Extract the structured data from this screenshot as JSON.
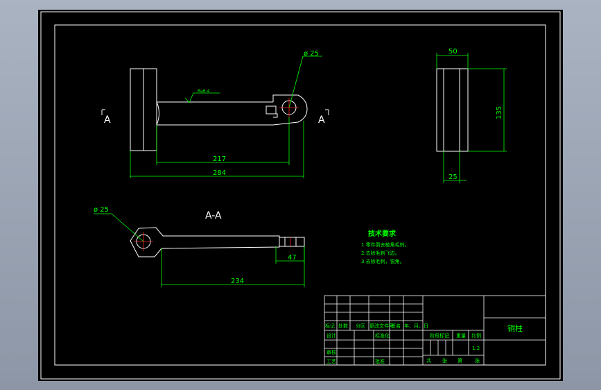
{
  "colors": {
    "background": "#000000",
    "outline": "#ffffff",
    "dimension": "#00ff00",
    "centerline": "#ff2020",
    "window": "#9aa3b3"
  },
  "labels": {
    "dia_top": "ø 25",
    "roughness": "Ra6.4",
    "section_left": "A",
    "section_right": "A",
    "dim_217": "217",
    "dim_284": "284",
    "dim_50": "50",
    "dim_135": "135",
    "dim_25": "25",
    "section_title": "A-A",
    "dia_section": "ø 25",
    "dim_47": "47",
    "dim_234": "234"
  },
  "tech": {
    "title": "技术要求",
    "items": [
      "1.零件倒去棱角毛刺。",
      "2.去除毛刺飞边。",
      "3.去除毛刺，锐角。"
    ]
  },
  "titleblock": {
    "part_name": "铜柱",
    "row_labels": [
      "标记",
      "处数",
      "分区",
      "更改文件号",
      "签名",
      "年、月、日"
    ],
    "design": "设计",
    "standard": "标准化",
    "check": "审核",
    "process": "工艺",
    "approve": "批准",
    "stage_mark": "阶段标记",
    "weight": "重量",
    "scale": "比例",
    "scale_value": "1:2",
    "sheet_total": "共",
    "sheet_label": "张",
    "sheet_no": "第",
    "sheet_label2": "张"
  }
}
